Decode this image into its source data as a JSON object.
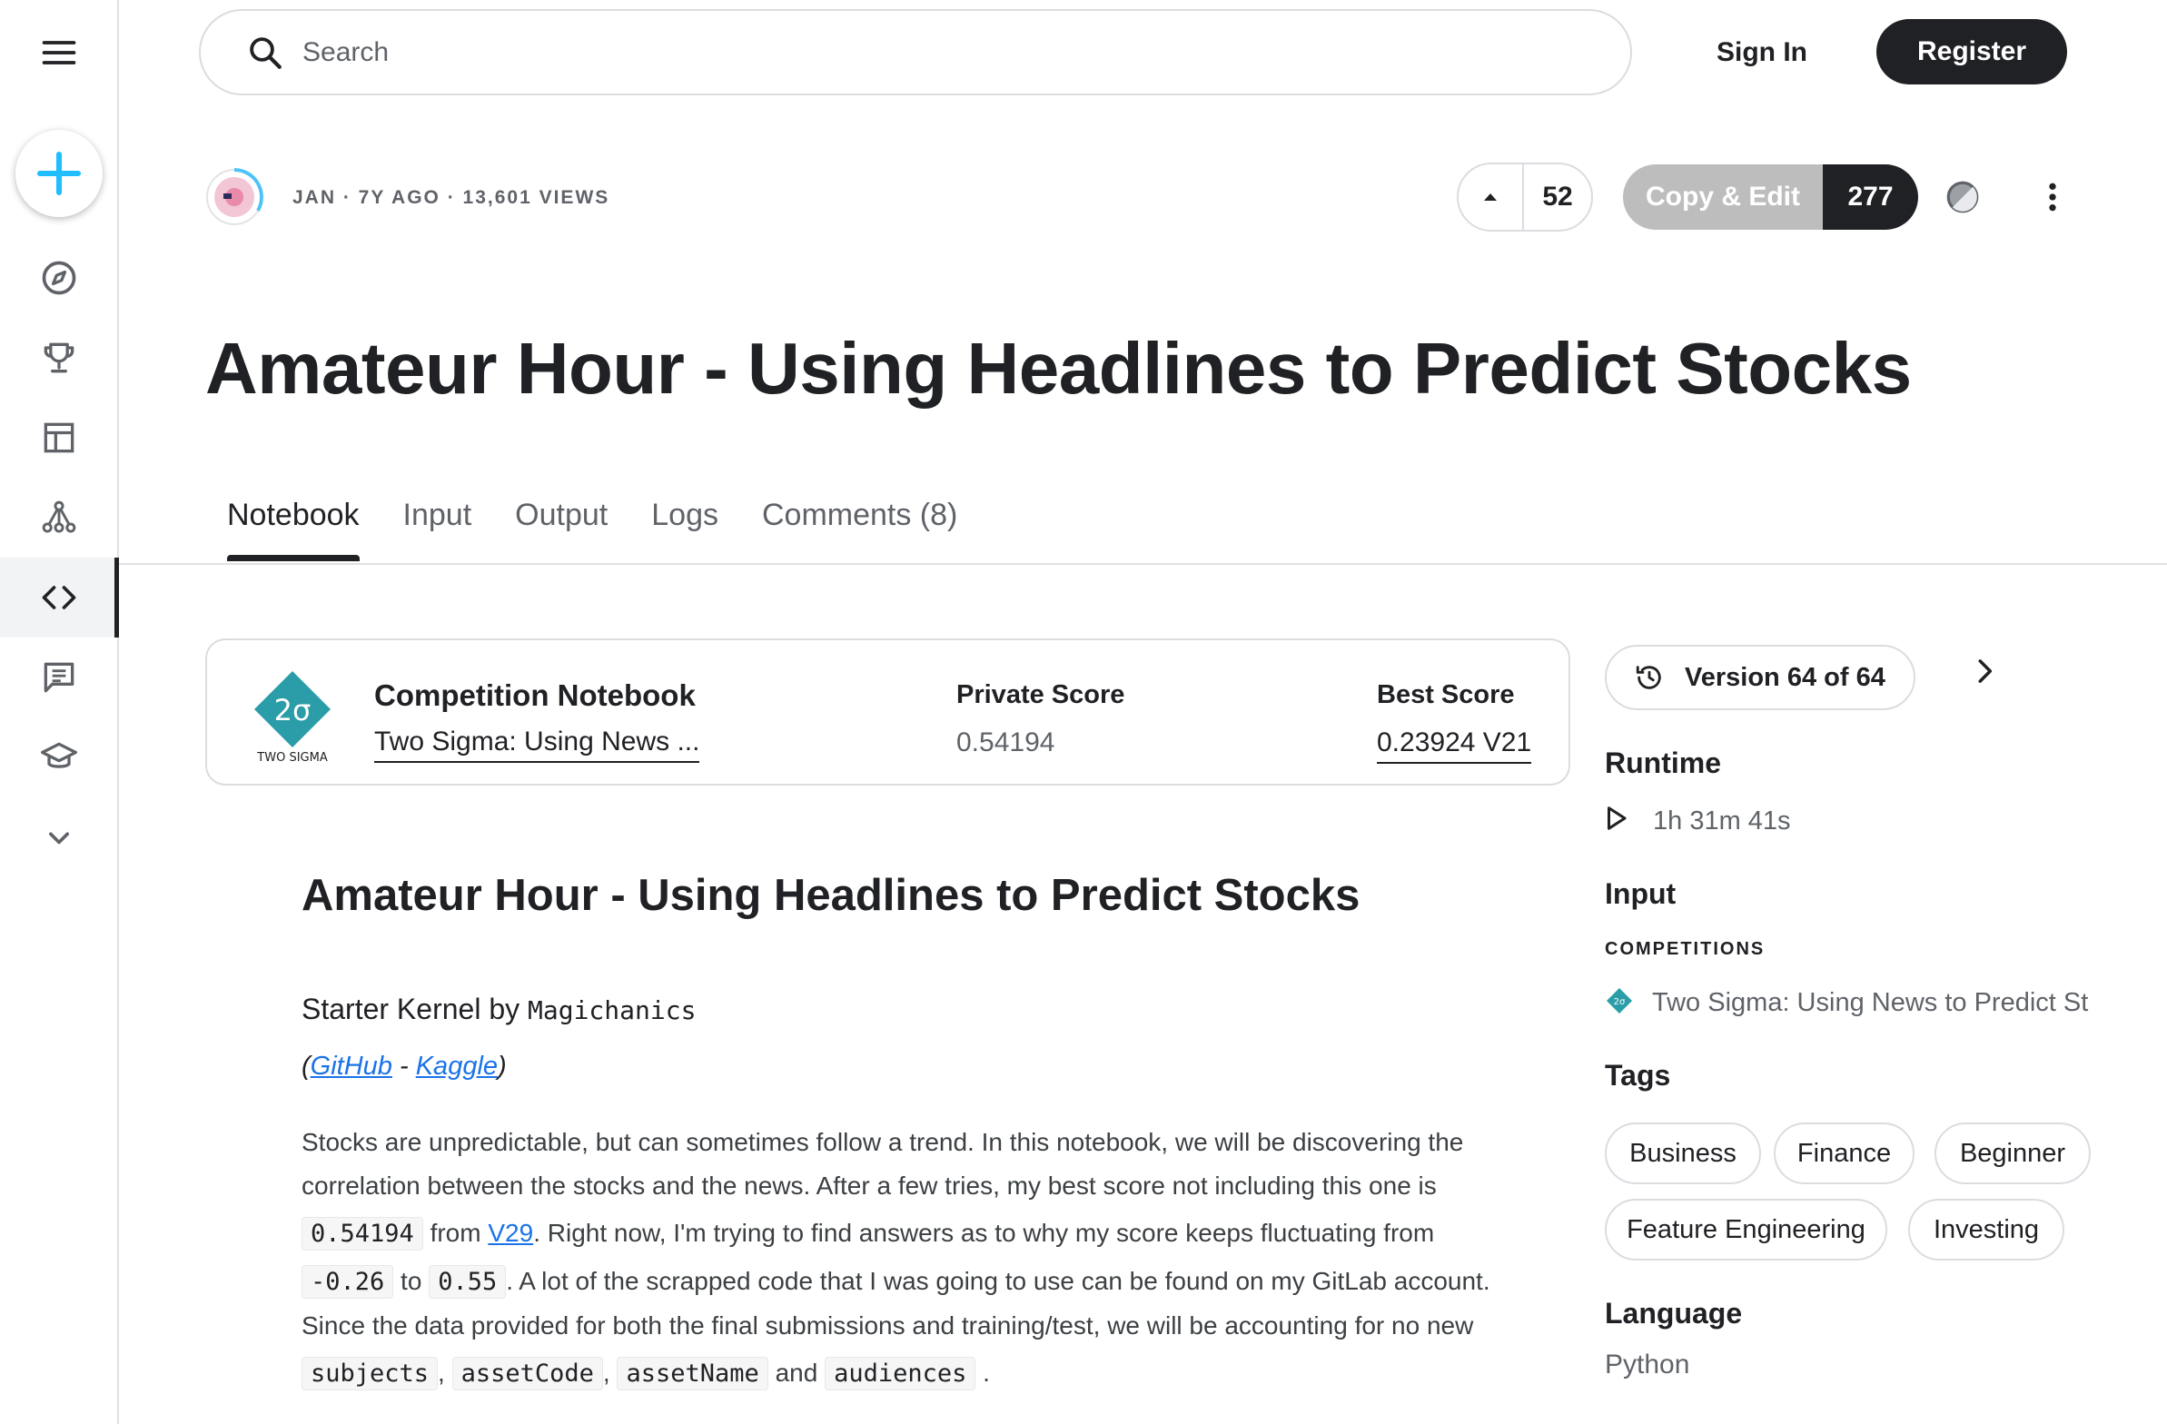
{
  "sidebar": {
    "items": [
      {
        "icon": "menu-icon"
      },
      {
        "icon": "plus-icon",
        "accent": "#20beff"
      },
      {
        "icon": "compass-icon"
      },
      {
        "icon": "trophy-icon"
      },
      {
        "icon": "table-icon"
      },
      {
        "icon": "models-icon"
      },
      {
        "icon": "code-icon",
        "active": true
      },
      {
        "icon": "discussion-icon"
      },
      {
        "icon": "learn-icon"
      },
      {
        "icon": "chevron-down-icon"
      }
    ]
  },
  "header": {
    "search_placeholder": "Search",
    "sign_in": "Sign In",
    "register": "Register"
  },
  "notebook_meta": {
    "author_line": "JAN · 7Y AGO · 13,601 VIEWS",
    "votes": "52",
    "copy_edit_label": "Copy & Edit",
    "copy_edit_count": "277"
  },
  "title": "Amateur Hour - Using Headlines to Predict Stocks",
  "tabs": [
    {
      "label": "Notebook",
      "active": true
    },
    {
      "label": "Input"
    },
    {
      "label": "Output"
    },
    {
      "label": "Logs"
    },
    {
      "label": "Comments (8)"
    }
  ],
  "competition_card": {
    "logo_text": "2σ",
    "logo_caption": "TWO SIGMA",
    "heading": "Competition Notebook",
    "competition_link": "Two Sigma: Using News ...",
    "private_score_label": "Private Score",
    "private_score": "0.54194",
    "best_score_label": "Best Score",
    "best_score": "0.23924 V21",
    "logo_color": "#2a9da8"
  },
  "notebook_body": {
    "heading": "Amateur Hour - Using Headlines to Predict Stocks",
    "starter_prefix": "Starter Kernel by ",
    "starter_author": "Magichanics",
    "link_open": "(",
    "github": "GitHub",
    "link_sep": " - ",
    "kaggle": "Kaggle",
    "link_close": ")",
    "p_line1": "Stocks are unpredictable, but can sometimes follow a trend. In this notebook, we will be discovering the",
    "p_line2": "correlation between the stocks and the news. After a few tries, my best score not including this one is",
    "code_score": "0.54194",
    "p_from": " from ",
    "link_v29": "V29",
    "p_line3_rest": ". Right now, I'm trying to find answers as to why my score keeps fluctuating from",
    "code_low": "-0.26",
    "p_to": " to ",
    "code_high": "0.55",
    "p_line4_rest": ". A lot of the scrapped code that I was going to use can be found on my GitLab account.",
    "p_line5": "Since the data provided for both the final submissions and training/test, we will be accounting for no new",
    "code_subjects": "subjects",
    "comma": ", ",
    "code_assetcode": "assetCode",
    "code_assetname": "assetName",
    "p_and": " and ",
    "code_audiences": "audiences",
    "p_end": " ."
  },
  "right_panel": {
    "version_label": "Version 64 of 64",
    "runtime_heading": "Runtime",
    "runtime_value": "1h 31m 41s",
    "input_heading": "Input",
    "competitions_caption": "COMPETITIONS",
    "input_competition": "Two Sigma: Using News to Predict St",
    "tags_heading": "Tags",
    "tags": [
      "Business",
      "Finance",
      "Beginner",
      "Feature Engineering",
      "Investing"
    ],
    "language_heading": "Language",
    "language_value": "Python"
  }
}
